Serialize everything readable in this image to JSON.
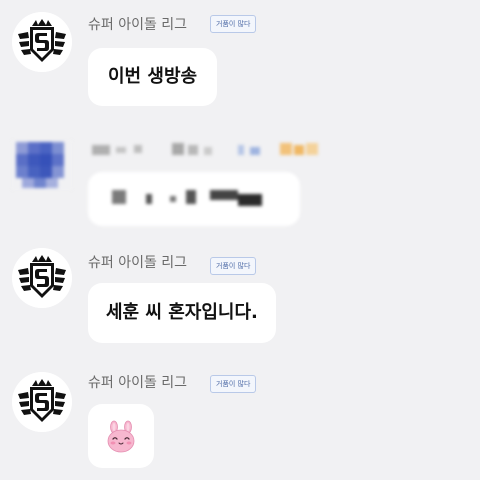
{
  "messages": [
    {
      "sender": "슈퍼 아이돌 리그",
      "badge": "거품이 많다",
      "text": "이번 생방송",
      "avatar_icon": "s-shield-logo-icon"
    },
    {
      "sender": "슈퍼 아이돌 리그",
      "badge": "거품이 많다",
      "text": "세훈 씨 혼자입니다.",
      "avatar_icon": "s-shield-logo-icon"
    },
    {
      "sender": "슈퍼 아이돌 리그",
      "badge": "거품이 많다",
      "emoji": "pink-bunny-emoticon",
      "avatar_icon": "s-shield-logo-icon"
    }
  ],
  "colors": {
    "background": "#f1f1f3",
    "bubble": "#ffffff",
    "badge_border": "#b9c9e8",
    "badge_text": "#4d6aa6",
    "bunny_pink": "#f7b7cf"
  }
}
